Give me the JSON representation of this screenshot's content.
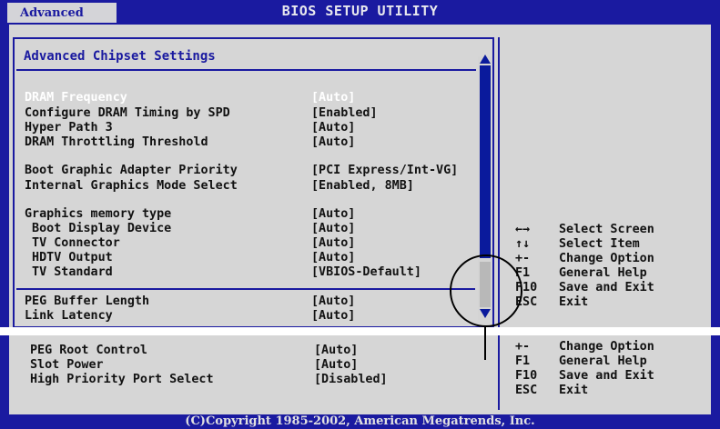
{
  "header": {
    "title": "BIOS SETUP UTILITY",
    "active_tab": "Advanced"
  },
  "section_title": "Advanced Chipset Settings",
  "settings_upper": [
    {
      "label": "DRAM Frequency",
      "value": "[Auto]",
      "selected": true
    },
    {
      "label": "Configure DRAM Timing by SPD",
      "value": "[Enabled]"
    },
    {
      "label": "Hyper Path 3",
      "value": "[Auto]"
    },
    {
      "label": "DRAM Throttling Threshold",
      "value": "[Auto]"
    },
    {
      "label": "Boot Graphic Adapter Priority",
      "value": "[PCI Express/Int-VG]"
    },
    {
      "label": "Internal Graphics Mode Select",
      "value": "[Enabled, 8MB]"
    },
    {
      "label": "Graphics memory type",
      "value": "[Auto]"
    },
    {
      "label": " Boot Display Device",
      "value": "[Auto]"
    },
    {
      "label": " TV Connector",
      "value": "[Auto]"
    },
    {
      "label": " HDTV Output",
      "value": "[Auto]"
    },
    {
      "label": " TV Standard",
      "value": "[VBIOS-Default]"
    },
    {
      "label": "PEG Buffer Length",
      "value": "[Auto]"
    },
    {
      "label": "Link Latency",
      "value": "[Auto]"
    }
  ],
  "settings_lower": [
    {
      "label": "PEG Root Control",
      "value": "[Auto]"
    },
    {
      "label": "Slot Power",
      "value": "[Auto]"
    },
    {
      "label": "High Priority Port Select",
      "value": "[Disabled]"
    }
  ],
  "help_keys_upper": [
    {
      "key": "←→",
      "desc": "Select Screen"
    },
    {
      "key": "↑↓",
      "desc": "Select Item"
    },
    {
      "key": "+-",
      "desc": "Change Option"
    },
    {
      "key": "F1",
      "desc": "General Help"
    },
    {
      "key": "F10",
      "desc": "Save and Exit"
    },
    {
      "key": "ESC",
      "desc": "Exit"
    }
  ],
  "help_keys_lower": [
    {
      "key": "+-",
      "desc": "Change Option"
    },
    {
      "key": "F1",
      "desc": "General Help"
    },
    {
      "key": "F10",
      "desc": "Save and Exit"
    },
    {
      "key": "ESC",
      "desc": "Exit"
    }
  ],
  "footer": {
    "copyright": "(C)Copyright 1985-2002, American Megatrends, Inc."
  },
  "colors": {
    "bios_blue": "#1a1aa0",
    "panel_gray": "#d6d6d6",
    "selected_text": "#ffffff"
  }
}
